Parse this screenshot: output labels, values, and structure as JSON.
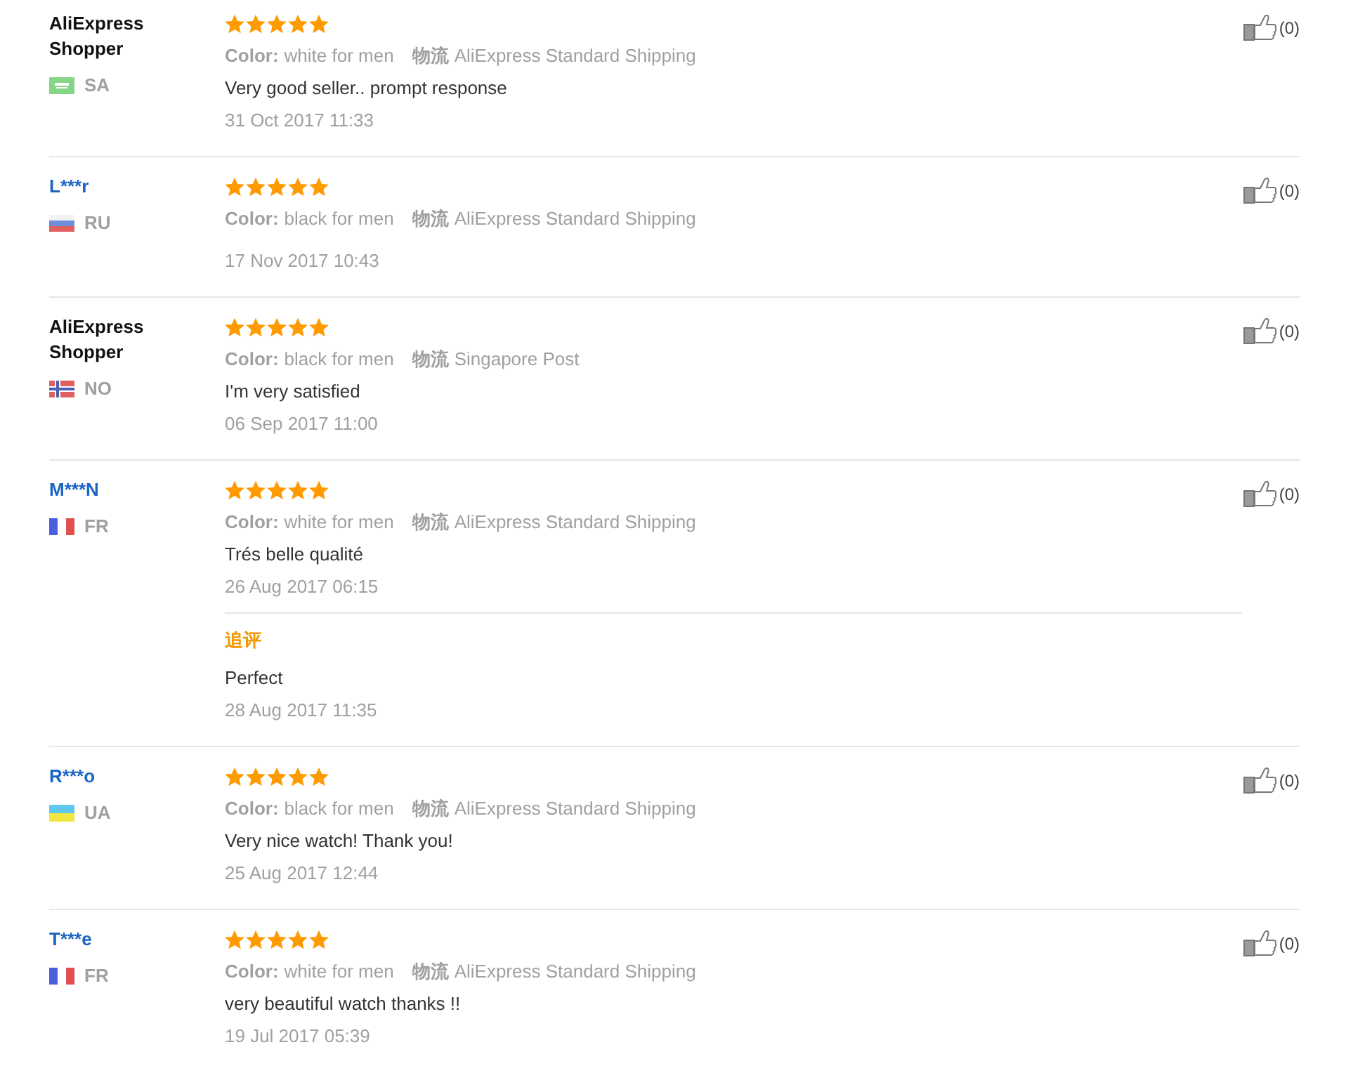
{
  "reviews": [
    {
      "reviewer": {
        "name": "AliExpress Shopper",
        "link": false,
        "country": "SA",
        "flag": {
          "kind": "emblem",
          "stripes": [
            {
              "color": "#86d486"
            },
            {
              "color": "#ffffff"
            }
          ]
        }
      },
      "stars": 5,
      "attributes": [
        {
          "label": "Color:",
          "value": "white for men"
        },
        {
          "label": "物流",
          "value": "AliExpress Standard Shipping"
        }
      ],
      "text": "Very good seller.. prompt response",
      "date": "31 Oct 2017 11:33",
      "helpful": "(0)"
    },
    {
      "reviewer": {
        "name": "L***r",
        "link": true,
        "country": "RU",
        "flag": {
          "kind": "horizontal",
          "stripes": [
            {
              "color": "#f2f2f2"
            },
            {
              "color": "#6e8fd8"
            },
            {
              "color": "#e06060"
            }
          ]
        }
      },
      "stars": 5,
      "attributes": [
        {
          "label": "Color:",
          "value": "black for men"
        },
        {
          "label": "物流",
          "value": "AliExpress Standard Shipping"
        }
      ],
      "date": "17 Nov 2017 10:43",
      "helpful": "(0)"
    },
    {
      "reviewer": {
        "name": "AliExpress Shopper",
        "link": false,
        "country": "NO",
        "flag": {
          "kind": "cross",
          "stripes": [
            {
              "color": "#e06060"
            },
            {
              "color": "#ffffff"
            },
            {
              "color": "#4a5fb0"
            }
          ]
        }
      },
      "stars": 5,
      "attributes": [
        {
          "label": "Color:",
          "value": "black for men"
        },
        {
          "label": "物流",
          "value": "Singapore Post"
        }
      ],
      "text": "I'm very satisfied",
      "date": "06 Sep 2017 11:00",
      "helpful": "(0)"
    },
    {
      "reviewer": {
        "name": "M***N",
        "link": true,
        "country": "FR",
        "flag": {
          "kind": "vertical",
          "stripes": [
            {
              "color": "#4a5ee0"
            },
            {
              "color": "#ffffff"
            },
            {
              "color": "#e05050"
            }
          ]
        }
      },
      "stars": 5,
      "attributes": [
        {
          "label": "Color:",
          "value": "white for men"
        },
        {
          "label": "物流",
          "value": "AliExpress Standard Shipping"
        }
      ],
      "text": "Trés belle qualité",
      "date": "26 Aug 2017 06:15",
      "follow_up": {
        "label": "追评",
        "text": "Perfect",
        "date": "28 Aug 2017 11:35"
      },
      "helpful": "(0)"
    },
    {
      "reviewer": {
        "name": "R***o",
        "link": true,
        "country": "UA",
        "flag": {
          "kind": "horizontal",
          "stripes": [
            {
              "color": "#5fc8f0"
            },
            {
              "color": "#f2e640"
            }
          ]
        }
      },
      "stars": 5,
      "attributes": [
        {
          "label": "Color:",
          "value": "black for men"
        },
        {
          "label": "物流",
          "value": "AliExpress Standard Shipping"
        }
      ],
      "text": "Very nice watch! Thank you!",
      "date": "25 Aug 2017 12:44",
      "helpful": "(0)"
    },
    {
      "reviewer": {
        "name": "T***e",
        "link": true,
        "country": "FR",
        "flag": {
          "kind": "vertical",
          "stripes": [
            {
              "color": "#4a5ee0"
            },
            {
              "color": "#ffffff"
            },
            {
              "color": "#e05050"
            }
          ]
        }
      },
      "stars": 5,
      "attributes": [
        {
          "label": "Color:",
          "value": "white for men"
        },
        {
          "label": "物流",
          "value": "AliExpress Standard Shipping"
        }
      ],
      "text": "very beautiful watch thanks !!",
      "date": "19 Jul 2017 05:39",
      "helpful": "(0)"
    }
  ]
}
